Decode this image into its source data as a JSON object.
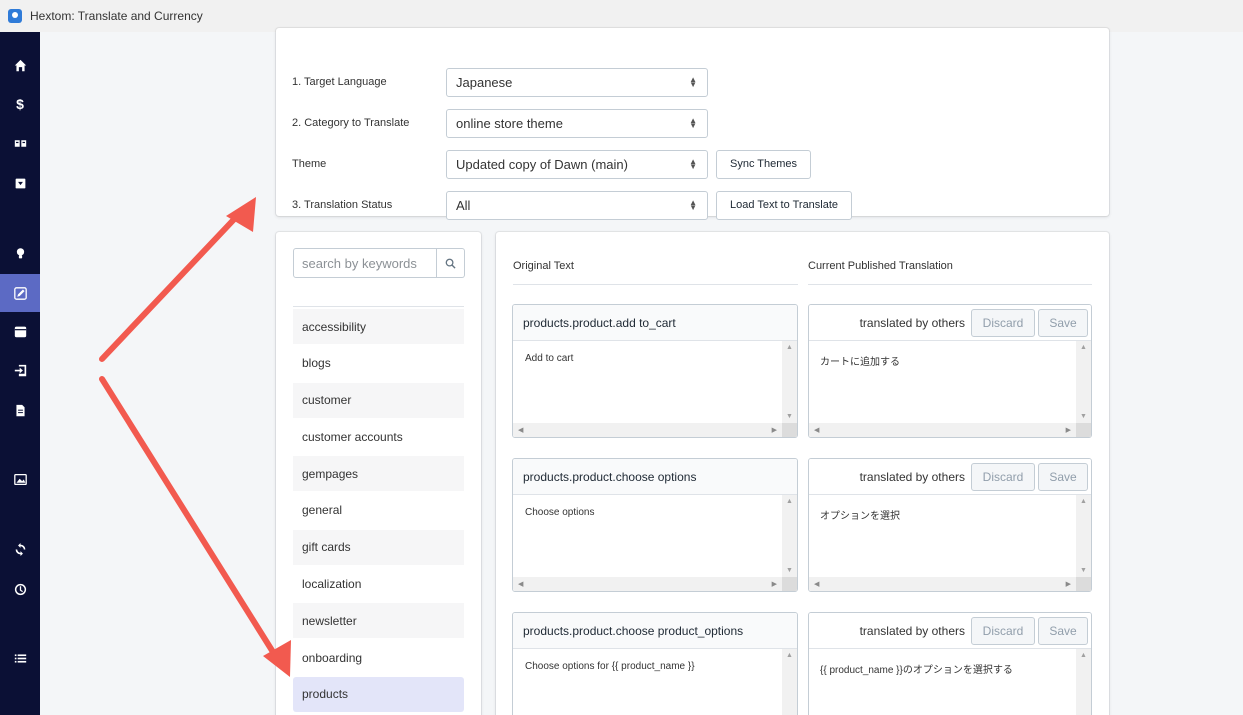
{
  "window": {
    "title": "Hextom: Translate and Currency"
  },
  "sidebar": {
    "icons": [
      "home-icon",
      "dollar-icon",
      "language-icon",
      "dropdown-icon",
      "bulb-icon",
      "edit-icon",
      "calendar-icon",
      "import-icon",
      "document-icon",
      "image-icon",
      "sync-icon",
      "history-icon",
      "list-icon"
    ],
    "active": "edit-icon"
  },
  "settings": {
    "target_language": {
      "label": "1. Target Language",
      "value": "Japanese"
    },
    "category": {
      "label": "2. Category to Translate",
      "value": "online store theme"
    },
    "theme": {
      "label": "Theme",
      "value": "Updated copy of Dawn (main)",
      "button": "Sync Themes"
    },
    "status": {
      "label": "3. Translation Status",
      "value": "All",
      "button": "Load Text to Translate"
    }
  },
  "categories": {
    "search_placeholder": "search by keywords",
    "items": [
      "accessibility",
      "blogs",
      "customer",
      "customer accounts",
      "gempages",
      "general",
      "gift cards",
      "localization",
      "newsletter",
      "onboarding",
      "products"
    ],
    "selected": "products"
  },
  "translations": {
    "original_header": "Original Text",
    "current_header": "Current Published Translation",
    "status_label": "translated by others",
    "discard_label": "Discard",
    "save_label": "Save",
    "rows": [
      {
        "key": "products.product.add to_cart",
        "original": "Add to cart",
        "translation": "カートに追加する"
      },
      {
        "key": "products.product.choose options",
        "original": "Choose options",
        "translation": "オプションを選択"
      },
      {
        "key": "products.product.choose product_options",
        "original": "Choose options for {{ product_name }}",
        "translation": "{{ product_name }}のオプションを選択する"
      }
    ]
  },
  "colors": {
    "sidebar": "#0b1035",
    "sidebar_active": "#5c6ac4",
    "selected_category": "#e3e5f9",
    "annotation_arrow": "#f25a4f"
  }
}
